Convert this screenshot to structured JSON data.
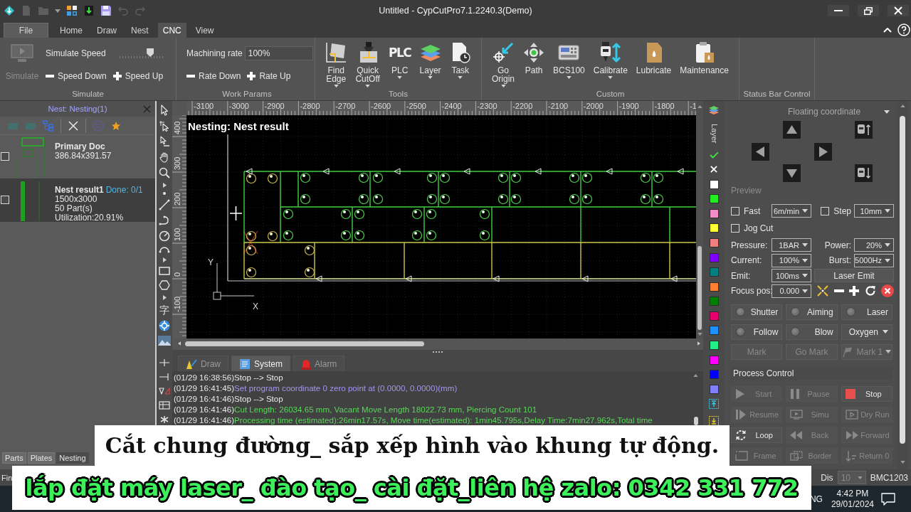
{
  "title_bar": {
    "title": "Untitled - CypCutPro7.1.2240.3(Demo)",
    "quick_access": [
      {
        "kind": "app",
        "disabled": false
      },
      {
        "kind": "new",
        "disabled": true
      },
      {
        "kind": "open",
        "disabled": true
      },
      {
        "kind": "more",
        "disabled": false
      },
      {
        "kind": "layout",
        "disabled": false
      },
      {
        "kind": "import",
        "disabled": false
      },
      {
        "kind": "save",
        "disabled": false
      },
      {
        "kind": "undo",
        "disabled": true
      },
      {
        "kind": "redo",
        "disabled": true
      }
    ]
  },
  "menu": [
    {
      "label": "File",
      "kind": "app_menu",
      "selected": false
    },
    {
      "label": "Home",
      "kind": "tab",
      "selected": false
    },
    {
      "label": "Draw",
      "kind": "tab",
      "selected": false
    },
    {
      "label": "Nest",
      "kind": "tab",
      "selected": false
    },
    {
      "label": "CNC",
      "kind": "tab",
      "selected": true
    },
    {
      "label": "View",
      "kind": "tab",
      "selected": false
    }
  ],
  "ribbon": {
    "simulate": {
      "label": "Simulate",
      "button": "Simulate",
      "button_disabled": true,
      "speed_label": "Simulate Speed",
      "speed": {
        "level": 0.7
      },
      "speed_down": "Speed Down",
      "speed_up": "Speed Up"
    },
    "work_params": {
      "label": "Work Params",
      "rate_label": "Machining rate",
      "rate_value": "100%",
      "rate_down": "Rate Down",
      "rate_up": "Rate Up"
    },
    "tools": {
      "label": "Tools",
      "buttons": [
        {
          "label": "Find Edge",
          "kind": "find_edge",
          "dropdown": true
        },
        {
          "label": "Quick CutOff",
          "kind": "quick_cutoff",
          "dropdown": true
        },
        {
          "label": "PLC",
          "kind": "plc",
          "glyph": "PLC",
          "dropdown": true
        },
        {
          "label": "Layer",
          "kind": "layer",
          "dropdown": true
        },
        {
          "label": "Task",
          "kind": "task",
          "dropdown": true
        }
      ]
    },
    "custom": {
      "label": "Custom",
      "buttons": [
        {
          "label": "Go Origin",
          "kind": "go_origin",
          "dropdown": true
        },
        {
          "label": "Path",
          "kind": "path",
          "dropdown": false
        },
        {
          "label": "BCS100",
          "kind": "bcs100",
          "dropdown": true
        },
        {
          "label": "Calibrate",
          "kind": "calibrate",
          "dropdown": true
        },
        {
          "label": "Lubricate",
          "kind": "lubricate",
          "dropdown": false
        },
        {
          "label": "Maintenance",
          "kind": "maintenance",
          "dropdown": false
        }
      ]
    },
    "status_bar_control": {
      "label": "Status Bar Control"
    }
  },
  "nest_panel": {
    "title": "Nest: Nesting(1)",
    "tools": [
      {
        "kind": "add",
        "disabled": true
      },
      {
        "kind": "copy",
        "disabled": true
      },
      {
        "kind": "tree",
        "disabled": false
      },
      {
        "kind": "delete",
        "disabled": false
      },
      {
        "kind": "layers",
        "disabled": true
      },
      {
        "kind": "star",
        "disabled": false
      }
    ],
    "items": [
      {
        "kind": "doc",
        "name": "Primary Doc",
        "lines": [
          "386.84x391.57"
        ],
        "checked": false,
        "selected": false
      },
      {
        "kind": "result",
        "name": "Nest result1",
        "status": "Done: 0/1",
        "lines": [
          "1500x3000",
          "50 Part(s)",
          "Utilization:20.91%"
        ],
        "checked": false,
        "selected": true
      }
    ],
    "tabs": [
      {
        "label": "Parts",
        "selected": false
      },
      {
        "label": "Plates",
        "selected": false
      },
      {
        "label": "Nesting",
        "selected": true
      }
    ]
  },
  "draw_toolbar": {
    "text_tool": "字"
  },
  "canvas": {
    "title": "Nesting: Nest result",
    "x_ruler": [
      "-3100",
      "-3000",
      "-2900",
      "-2800",
      "-2700",
      "-2600",
      "-2500",
      "-2400",
      "-2300",
      "-2200",
      "-2100",
      "-2000",
      "-1900",
      "-1800",
      "-1"
    ],
    "y_ruler": [
      "400",
      "300",
      "200",
      "100",
      "0",
      "-100"
    ],
    "axis_y": "Y",
    "axis_x": "X"
  },
  "log": {
    "tabs": [
      {
        "label": "Draw",
        "kind": "draw",
        "selected": false
      },
      {
        "label": "System",
        "kind": "system",
        "selected": true
      },
      {
        "label": "Alarm",
        "kind": "alarm",
        "selected": false
      }
    ],
    "lines": [
      {
        "time": "(01/29 16:38:56)",
        "message": "Stop --> Stop",
        "kind": "plain"
      },
      {
        "time": "(01/29 16:41:45)",
        "message": "Set program coordinate 0 zero point at (0.0000, 0.0000)(mm)",
        "kind": "notice"
      },
      {
        "time": "(01/29 16:41:46)",
        "message": "Stop --> Stop",
        "kind": "plain"
      },
      {
        "time": "(01/29 16:41:46)",
        "message": "Cut Length: 26034.65 mm, Vacant Move Length 18022.73 mm, Piercing Count 101",
        "kind": "result"
      },
      {
        "time": "(01/29 16:41:46)",
        "message": "Processing time (estimated):26min17.57s, Move time(estimated): 1min45.795s,Delay Time:7min27.962s,Total time",
        "kind": "result"
      }
    ]
  },
  "layer_bar": {
    "title": "Layer",
    "layers": [
      {
        "color": "#ffffff"
      },
      {
        "color": "#22ee22"
      },
      {
        "color": "#f58ac8"
      },
      {
        "color": "#ffff33"
      },
      {
        "color": "#f08080"
      },
      {
        "color": "#8000ff"
      },
      {
        "color": "#008080"
      },
      {
        "color": "#ff8030"
      },
      {
        "color": "#008000"
      },
      {
        "color": "#e8006e"
      },
      {
        "color": "#1e90ff"
      },
      {
        "color": "#22ee88"
      },
      {
        "color": "#ff00ff"
      },
      {
        "color": "#0000ff"
      },
      {
        "color": "#8080ff"
      }
    ]
  },
  "control": {
    "coordinate_mode": "Floating coordinate",
    "preview": "Preview",
    "fast": {
      "label": "Fast",
      "checked": false,
      "value": "6m/min"
    },
    "step": {
      "label": "Step",
      "checked": false,
      "value": "10mm"
    },
    "jog_cut": {
      "label": "Jog Cut",
      "checked": false
    },
    "params": [
      {
        "label": "Pressure:",
        "value": "1BAR"
      },
      {
        "label": "Power:",
        "value": "20%"
      },
      {
        "label": "Current:",
        "value": "100%"
      },
      {
        "label": "Burst:",
        "value": "5000Hz"
      },
      {
        "label": "Emit:",
        "value": "100ms"
      }
    ],
    "laser_emit": "Laser Emit",
    "focus": {
      "label": "Focus pos:",
      "value": "0.000"
    },
    "switches": [
      {
        "label": "Shutter",
        "kind": "led",
        "on": false
      },
      {
        "label": "Aiming",
        "kind": "led",
        "on": false
      },
      {
        "label": "Laser",
        "kind": "led",
        "on": false
      },
      {
        "label": "Follow",
        "kind": "led",
        "on": false
      },
      {
        "label": "Blow",
        "kind": "led",
        "on": false
      },
      {
        "label": "Oxygen",
        "kind": "gas"
      }
    ],
    "marks": [
      {
        "label": "Mark",
        "kind": "mark",
        "disabled": true
      },
      {
        "label": "Go Mark",
        "kind": "go_mark",
        "disabled": true
      },
      {
        "label": "Mark 1",
        "kind": "mark_select",
        "disabled": true
      }
    ],
    "process_title": "Process Control",
    "process": [
      {
        "label": "Start",
        "kind": "start",
        "disabled": true
      },
      {
        "label": "Pause",
        "kind": "pause",
        "disabled": true
      },
      {
        "label": "Stop",
        "kind": "stop",
        "disabled": false
      },
      {
        "label": "Resume",
        "kind": "resume",
        "disabled": true
      },
      {
        "label": "Simu",
        "kind": "simu",
        "disabled": true
      },
      {
        "label": "Dry Run",
        "kind": "dry_run",
        "disabled": true
      },
      {
        "label": "Loop",
        "kind": "loop",
        "disabled": false
      },
      {
        "label": "Back",
        "kind": "back",
        "disabled": true
      },
      {
        "label": "Forward",
        "kind": "forward",
        "disabled": true
      },
      {
        "label": "Frame",
        "kind": "frame",
        "disabled": true
      },
      {
        "label": "Border",
        "kind": "border",
        "disabled": true
      },
      {
        "label": "Return 0",
        "kind": "return",
        "disabled": true
      }
    ]
  },
  "status_bar": {
    "message": "Fin",
    "dis_label": "Dis",
    "dis_value": "10",
    "dis_disabled": true,
    "controller": "BMC1203"
  },
  "taskbar": {
    "language": "NG",
    "time": "4:42 PM",
    "date": "29/01/2024"
  },
  "captions": [
    {
      "kind": "subtitle",
      "text": "Cắt chung đường_ sắp xếp hình vào khung tự động."
    },
    {
      "kind": "promo",
      "text": "lắp đặt máy laser_ đào tạo_ cài đặt_liên hệ zalo: 0342 331 772"
    }
  ]
}
